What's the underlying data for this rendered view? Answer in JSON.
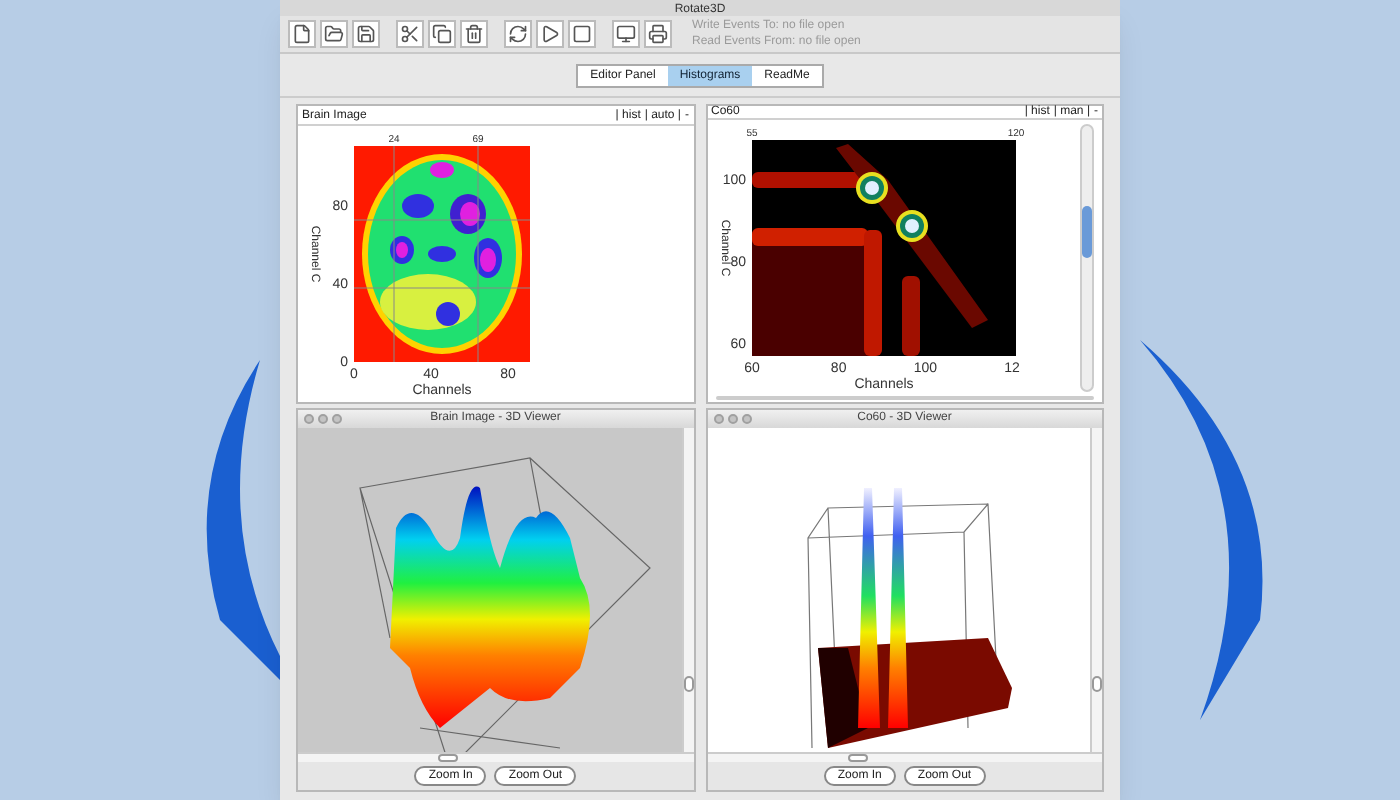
{
  "window": {
    "title": "Rotate3D"
  },
  "event_files": {
    "write": "Write Events To: no file open",
    "read": "Read Events From: no file open"
  },
  "tabs": [
    {
      "label": "Editor Panel",
      "selected": false
    },
    {
      "label": "Histograms",
      "selected": true
    },
    {
      "label": "ReadMe",
      "selected": false
    }
  ],
  "histograms": [
    {
      "kind": "brain",
      "title": "Brain Image",
      "options": [
        "| hist",
        "| auto |",
        "-"
      ],
      "top_ticks": [
        "24",
        "69"
      ],
      "xticks": [
        "0",
        "40",
        "80"
      ],
      "yticks": [
        "80",
        "40",
        "0"
      ],
      "xlabel": "Channels",
      "ylabel": "Channel C",
      "scrollable": false
    },
    {
      "kind": "co60",
      "title": "Co60",
      "options": [
        "| hist",
        "| man |",
        "-"
      ],
      "top_ticks": [
        "55",
        "120"
      ],
      "xticks": [
        "60",
        "80",
        "100",
        "12"
      ],
      "yticks": [
        "100",
        "80",
        "60"
      ],
      "xlabel": "Channels",
      "ylabel": "Channel C",
      "scrollable": true
    }
  ],
  "viewers": [
    {
      "kind": "brain",
      "title": "Brain Image - 3D Viewer",
      "buttons": [
        "Zoom In",
        "Zoom Out"
      ]
    },
    {
      "kind": "co60",
      "title": "Co60 - 3D Viewer",
      "buttons": [
        "Zoom In",
        "Zoom Out"
      ]
    }
  ]
}
